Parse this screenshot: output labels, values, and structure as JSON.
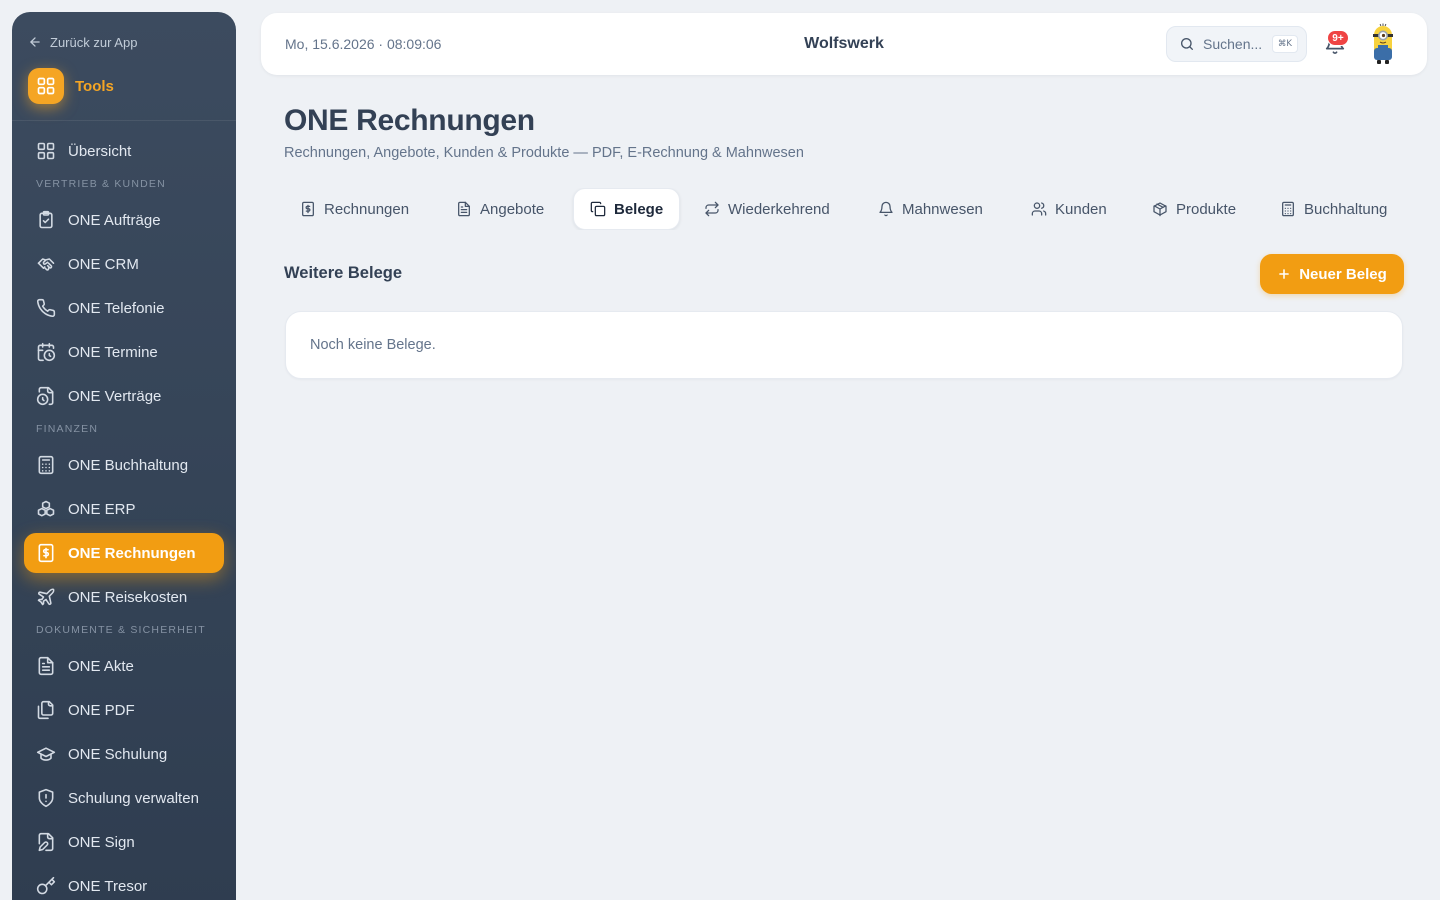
{
  "sidebar": {
    "back_label": "Zurück zur App",
    "brand_label": "Tools",
    "items": [
      {
        "type": "item",
        "label": "Übersicht",
        "icon": "grid-icon"
      },
      {
        "type": "section",
        "label": "VERTRIEB & KUNDEN"
      },
      {
        "type": "item",
        "label": "ONE Aufträge",
        "icon": "clipboard-check-icon"
      },
      {
        "type": "item",
        "label": "ONE CRM",
        "icon": "handshake-icon"
      },
      {
        "type": "item",
        "label": "ONE Telefonie",
        "icon": "phone-icon"
      },
      {
        "type": "item",
        "label": "ONE Termine",
        "icon": "calendar-clock-icon"
      },
      {
        "type": "item",
        "label": "ONE Verträge",
        "icon": "file-clock-icon"
      },
      {
        "type": "section",
        "label": "FINANZEN"
      },
      {
        "type": "item",
        "label": "ONE Buchhaltung",
        "icon": "calculator-icon"
      },
      {
        "type": "item",
        "label": "ONE ERP",
        "icon": "boxes-icon"
      },
      {
        "type": "item",
        "label": "ONE Rechnungen",
        "icon": "receipt-dollar-icon",
        "active": true
      },
      {
        "type": "item",
        "label": "ONE Reisekosten",
        "icon": "plane-icon"
      },
      {
        "type": "section",
        "label": "DOKUMENTE & SICHERHEIT"
      },
      {
        "type": "item",
        "label": "ONE Akte",
        "icon": "file-text-icon"
      },
      {
        "type": "item",
        "label": "ONE PDF",
        "icon": "files-icon"
      },
      {
        "type": "item",
        "label": "ONE Schulung",
        "icon": "graduation-cap-icon"
      },
      {
        "type": "item",
        "label": "Schulung verwalten",
        "icon": "shield-icon"
      },
      {
        "type": "item",
        "label": "ONE Sign",
        "icon": "file-pen-icon"
      },
      {
        "type": "item",
        "label": "ONE Tresor",
        "icon": "key-icon"
      }
    ]
  },
  "topbar": {
    "datetime": "Mo, 15.6.2026 · 08:09:06",
    "company": "Wolfswerk",
    "search_placeholder": "Suchen...",
    "search_shortcut": "⌘K",
    "notification_count": "9+"
  },
  "page": {
    "title": "ONE Rechnungen",
    "subtitle": "Rechnungen, Angebote, Kunden & Produkte — PDF, E-Rechnung & Mahnwesen"
  },
  "tabs": [
    {
      "label": "Rechnungen",
      "icon": "receipt-icon"
    },
    {
      "label": "Angebote",
      "icon": "file-text-icon"
    },
    {
      "label": "Belege",
      "icon": "copy-icon",
      "active": true
    },
    {
      "label": "Wiederkehrend",
      "icon": "repeat-icon"
    },
    {
      "label": "Mahnwesen",
      "icon": "bell-icon"
    },
    {
      "label": "Kunden",
      "icon": "users-icon"
    },
    {
      "label": "Produkte",
      "icon": "package-icon"
    },
    {
      "label": "Buchhaltung",
      "icon": "calculator-icon"
    }
  ],
  "section": {
    "title": "Weitere Belege",
    "new_button_label": "Neuer Beleg",
    "empty_text": "Noch keine Belege."
  },
  "colors": {
    "accent": "#f29d12",
    "sidebar_bg": "#3c4b5f",
    "page_bg": "#eef1f5",
    "badge": "#ef4444"
  }
}
